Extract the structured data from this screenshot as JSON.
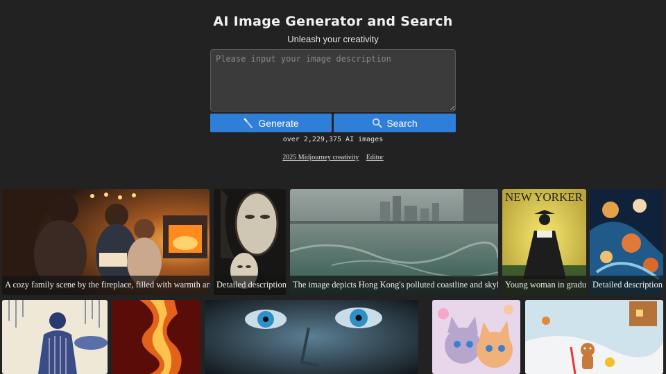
{
  "header": {
    "title": "AI Image Generator and Search",
    "subtitle": "Unleash your creativity"
  },
  "prompt": {
    "placeholder": "Please input your image description",
    "value": ""
  },
  "buttons": {
    "generate": "Generate",
    "search": "Search"
  },
  "stats": {
    "count_text": "over 2,229,375 AI images"
  },
  "links": {
    "midjourney": "2025 Midjourney creativity",
    "editor": "Editor"
  },
  "gallery": {
    "row1": [
      {
        "caption": "A cozy family scene by the fireplace, filled with warmth and l"
      },
      {
        "caption": "Detailed description c"
      },
      {
        "caption": "The image depicts Hong Kong's polluted coastline and skyline"
      },
      {
        "caption": "Young woman in gradua"
      },
      {
        "caption": "Detailed description c"
      }
    ],
    "row2": [
      {
        "caption": ""
      },
      {
        "caption": ""
      },
      {
        "caption": ""
      },
      {
        "caption": ""
      },
      {
        "caption": ""
      }
    ],
    "images": {
      "magazine_masthead": "NEW YORKER"
    }
  },
  "colors": {
    "background": "#222222",
    "accent": "#2f7fd8"
  }
}
